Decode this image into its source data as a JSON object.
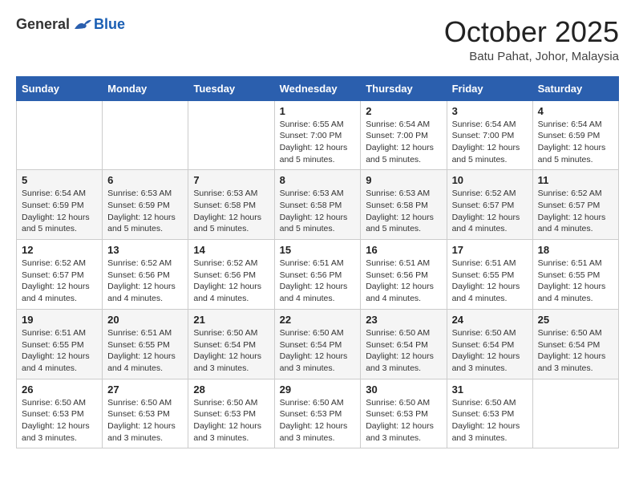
{
  "header": {
    "logo_general": "General",
    "logo_blue": "Blue",
    "month_title": "October 2025",
    "location": "Batu Pahat, Johor, Malaysia"
  },
  "weekdays": [
    "Sunday",
    "Monday",
    "Tuesday",
    "Wednesday",
    "Thursday",
    "Friday",
    "Saturday"
  ],
  "weeks": [
    [
      {
        "day": "",
        "info": ""
      },
      {
        "day": "",
        "info": ""
      },
      {
        "day": "",
        "info": ""
      },
      {
        "day": "1",
        "info": "Sunrise: 6:55 AM\nSunset: 7:00 PM\nDaylight: 12 hours\nand 5 minutes."
      },
      {
        "day": "2",
        "info": "Sunrise: 6:54 AM\nSunset: 7:00 PM\nDaylight: 12 hours\nand 5 minutes."
      },
      {
        "day": "3",
        "info": "Sunrise: 6:54 AM\nSunset: 7:00 PM\nDaylight: 12 hours\nand 5 minutes."
      },
      {
        "day": "4",
        "info": "Sunrise: 6:54 AM\nSunset: 6:59 PM\nDaylight: 12 hours\nand 5 minutes."
      }
    ],
    [
      {
        "day": "5",
        "info": "Sunrise: 6:54 AM\nSunset: 6:59 PM\nDaylight: 12 hours\nand 5 minutes."
      },
      {
        "day": "6",
        "info": "Sunrise: 6:53 AM\nSunset: 6:59 PM\nDaylight: 12 hours\nand 5 minutes."
      },
      {
        "day": "7",
        "info": "Sunrise: 6:53 AM\nSunset: 6:58 PM\nDaylight: 12 hours\nand 5 minutes."
      },
      {
        "day": "8",
        "info": "Sunrise: 6:53 AM\nSunset: 6:58 PM\nDaylight: 12 hours\nand 5 minutes."
      },
      {
        "day": "9",
        "info": "Sunrise: 6:53 AM\nSunset: 6:58 PM\nDaylight: 12 hours\nand 5 minutes."
      },
      {
        "day": "10",
        "info": "Sunrise: 6:52 AM\nSunset: 6:57 PM\nDaylight: 12 hours\nand 4 minutes."
      },
      {
        "day": "11",
        "info": "Sunrise: 6:52 AM\nSunset: 6:57 PM\nDaylight: 12 hours\nand 4 minutes."
      }
    ],
    [
      {
        "day": "12",
        "info": "Sunrise: 6:52 AM\nSunset: 6:57 PM\nDaylight: 12 hours\nand 4 minutes."
      },
      {
        "day": "13",
        "info": "Sunrise: 6:52 AM\nSunset: 6:56 PM\nDaylight: 12 hours\nand 4 minutes."
      },
      {
        "day": "14",
        "info": "Sunrise: 6:52 AM\nSunset: 6:56 PM\nDaylight: 12 hours\nand 4 minutes."
      },
      {
        "day": "15",
        "info": "Sunrise: 6:51 AM\nSunset: 6:56 PM\nDaylight: 12 hours\nand 4 minutes."
      },
      {
        "day": "16",
        "info": "Sunrise: 6:51 AM\nSunset: 6:56 PM\nDaylight: 12 hours\nand 4 minutes."
      },
      {
        "day": "17",
        "info": "Sunrise: 6:51 AM\nSunset: 6:55 PM\nDaylight: 12 hours\nand 4 minutes."
      },
      {
        "day": "18",
        "info": "Sunrise: 6:51 AM\nSunset: 6:55 PM\nDaylight: 12 hours\nand 4 minutes."
      }
    ],
    [
      {
        "day": "19",
        "info": "Sunrise: 6:51 AM\nSunset: 6:55 PM\nDaylight: 12 hours\nand 4 minutes."
      },
      {
        "day": "20",
        "info": "Sunrise: 6:51 AM\nSunset: 6:55 PM\nDaylight: 12 hours\nand 4 minutes."
      },
      {
        "day": "21",
        "info": "Sunrise: 6:50 AM\nSunset: 6:54 PM\nDaylight: 12 hours\nand 3 minutes."
      },
      {
        "day": "22",
        "info": "Sunrise: 6:50 AM\nSunset: 6:54 PM\nDaylight: 12 hours\nand 3 minutes."
      },
      {
        "day": "23",
        "info": "Sunrise: 6:50 AM\nSunset: 6:54 PM\nDaylight: 12 hours\nand 3 minutes."
      },
      {
        "day": "24",
        "info": "Sunrise: 6:50 AM\nSunset: 6:54 PM\nDaylight: 12 hours\nand 3 minutes."
      },
      {
        "day": "25",
        "info": "Sunrise: 6:50 AM\nSunset: 6:54 PM\nDaylight: 12 hours\nand 3 minutes."
      }
    ],
    [
      {
        "day": "26",
        "info": "Sunrise: 6:50 AM\nSunset: 6:53 PM\nDaylight: 12 hours\nand 3 minutes."
      },
      {
        "day": "27",
        "info": "Sunrise: 6:50 AM\nSunset: 6:53 PM\nDaylight: 12 hours\nand 3 minutes."
      },
      {
        "day": "28",
        "info": "Sunrise: 6:50 AM\nSunset: 6:53 PM\nDaylight: 12 hours\nand 3 minutes."
      },
      {
        "day": "29",
        "info": "Sunrise: 6:50 AM\nSunset: 6:53 PM\nDaylight: 12 hours\nand 3 minutes."
      },
      {
        "day": "30",
        "info": "Sunrise: 6:50 AM\nSunset: 6:53 PM\nDaylight: 12 hours\nand 3 minutes."
      },
      {
        "day": "31",
        "info": "Sunrise: 6:50 AM\nSunset: 6:53 PM\nDaylight: 12 hours\nand 3 minutes."
      },
      {
        "day": "",
        "info": ""
      }
    ]
  ]
}
